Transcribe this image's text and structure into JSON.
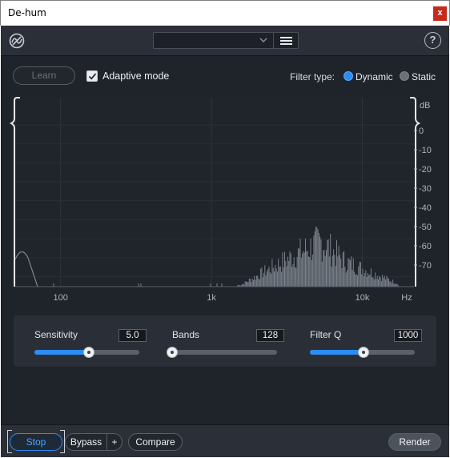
{
  "window": {
    "title": "De-hum",
    "close_label": "x"
  },
  "header": {
    "preset_value": ""
  },
  "toolbar": {
    "learn_label": "Learn",
    "adaptive_label": "Adaptive mode",
    "adaptive_checked": true,
    "filter_type_label": "Filter type:",
    "filter_options": [
      {
        "label": "Dynamic",
        "selected": true
      },
      {
        "label": "Static",
        "selected": false
      }
    ]
  },
  "spectrum": {
    "x_ticks": [
      "100",
      "1k",
      "10k",
      "Hz"
    ],
    "y_unit": "dB",
    "y_ticks": [
      "0",
      "-10",
      "-20",
      "-30",
      "-40",
      "-50",
      "-60",
      "-70"
    ]
  },
  "controls": [
    {
      "label": "Sensitivity",
      "value": "5.0",
      "fraction": 0.52
    },
    {
      "label": "Bands",
      "value": "128",
      "fraction": 0.0
    },
    {
      "label": "Filter Q",
      "value": "1000",
      "fraction": 0.51
    }
  ],
  "bottom": {
    "stop_label": "Stop",
    "bypass_label": "Bypass",
    "plus_label": "+",
    "compare_label": "Compare",
    "render_label": "Render"
  },
  "colors": {
    "accent": "#2d8cf0",
    "background": "#1f232a",
    "panel": "#2a2f37"
  }
}
